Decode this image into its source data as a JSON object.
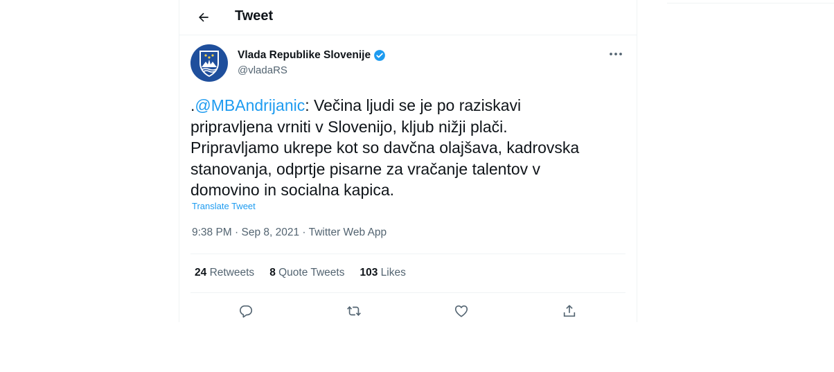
{
  "header": {
    "title": "Tweet"
  },
  "author": {
    "name": "Vlada Republike Slovenije",
    "handle": "@vladaRS"
  },
  "tweet": {
    "prefix": ".",
    "mention": "@MBAndrijanic",
    "body": ": Večina ljudi se je po raziskavi\npripravljena vrniti v Slovenijo, kljub nižji plači.\nPripravljamo ukrepe kot so davčna olajšava, kadrovska\nstanovanja, odprtje pisarne za vračanje talentov v\ndomovino in socialna kapica.",
    "translate": "Translate Tweet",
    "meta": "9:38 PM · Sep 8, 2021 · Twitter Web App"
  },
  "stats": [
    {
      "count": "24",
      "label": "Retweets"
    },
    {
      "count": "8",
      "label": "Quote Tweets"
    },
    {
      "count": "103",
      "label": "Likes"
    }
  ],
  "icons": {
    "back": "arrow-left-icon",
    "verified": "verified-badge-icon",
    "more": "more-icon",
    "reply": "reply-icon",
    "retweet": "retweet-icon",
    "like": "like-icon",
    "share": "share-icon"
  },
  "colors": {
    "accent": "#1d9bf0",
    "secondary_text": "#536471",
    "avatar_bg": "#1f4f9c"
  }
}
